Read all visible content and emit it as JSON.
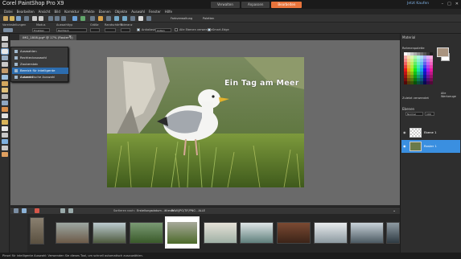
{
  "app": {
    "title": "Corel PaintShop Pro X9"
  },
  "tabs": [
    "Verwalten",
    "Anpassen",
    "Bearbeiten"
  ],
  "account": {
    "signin": "Jetzt Kaufen"
  },
  "menu": [
    "Datei",
    "Bearbeiten",
    "Ansicht",
    "Bild",
    "Korrektur",
    "Effekte",
    "Ebenen",
    "Objekte",
    "Auswahl",
    "Fenster",
    "Hilfe"
  ],
  "toolbar": {
    "workspace": "Farbverwaltung",
    "palette": "Paletten"
  },
  "options": {
    "labels": [
      "Voreinstellungen",
      "Modus",
      "Auswahltyp",
      "Größe",
      "Randschärfe",
      "Toleranz"
    ],
    "mode_value": "Ersetzen",
    "type_value": "Rechteck",
    "antialias_label": "Antialiasing",
    "style_value": "Außen",
    "sample_merged_label": "Alle Ebenen verwenden",
    "smart_edge_label": "Smart-Edge"
  },
  "document": {
    "tab_label": "IMG_1808.jpg* @ 17% (Raster 1)"
  },
  "canvas": {
    "caption": "Ein Tag am Meer",
    "accent": "#e8743b"
  },
  "selection_menu": {
    "items": [
      "Auswahlen",
      "Rechteckauswahl",
      "Zauberstab",
      "Bereich für intelligente Auswahl",
      "Automatische Auswahl"
    ],
    "highlighted_index": 3
  },
  "panels": {
    "materials": {
      "title": "Material",
      "palette_label": "Rahmenpalette",
      "all_tools_label": "Alle Werkzeuge"
    },
    "recent_label": "Zuletzt verwendet",
    "layers": {
      "title": "Ebenen",
      "blend_mode": "Normal",
      "opacity": "100",
      "items": [
        {
          "name": "Ebene 1"
        },
        {
          "name": "Raster 1"
        }
      ]
    }
  },
  "organizer": {
    "sort_label": "Sortieren nach:",
    "filter_label": "Erstellungsdatum - älteste",
    "type_label": "RAW/JPG/TIF/PNG - ALLE"
  },
  "statusbar": {
    "text": "Pinsel für intelligente Auswahl: Verwenden Sie dieses Tool, um schnell automatisch auszuwählen."
  }
}
